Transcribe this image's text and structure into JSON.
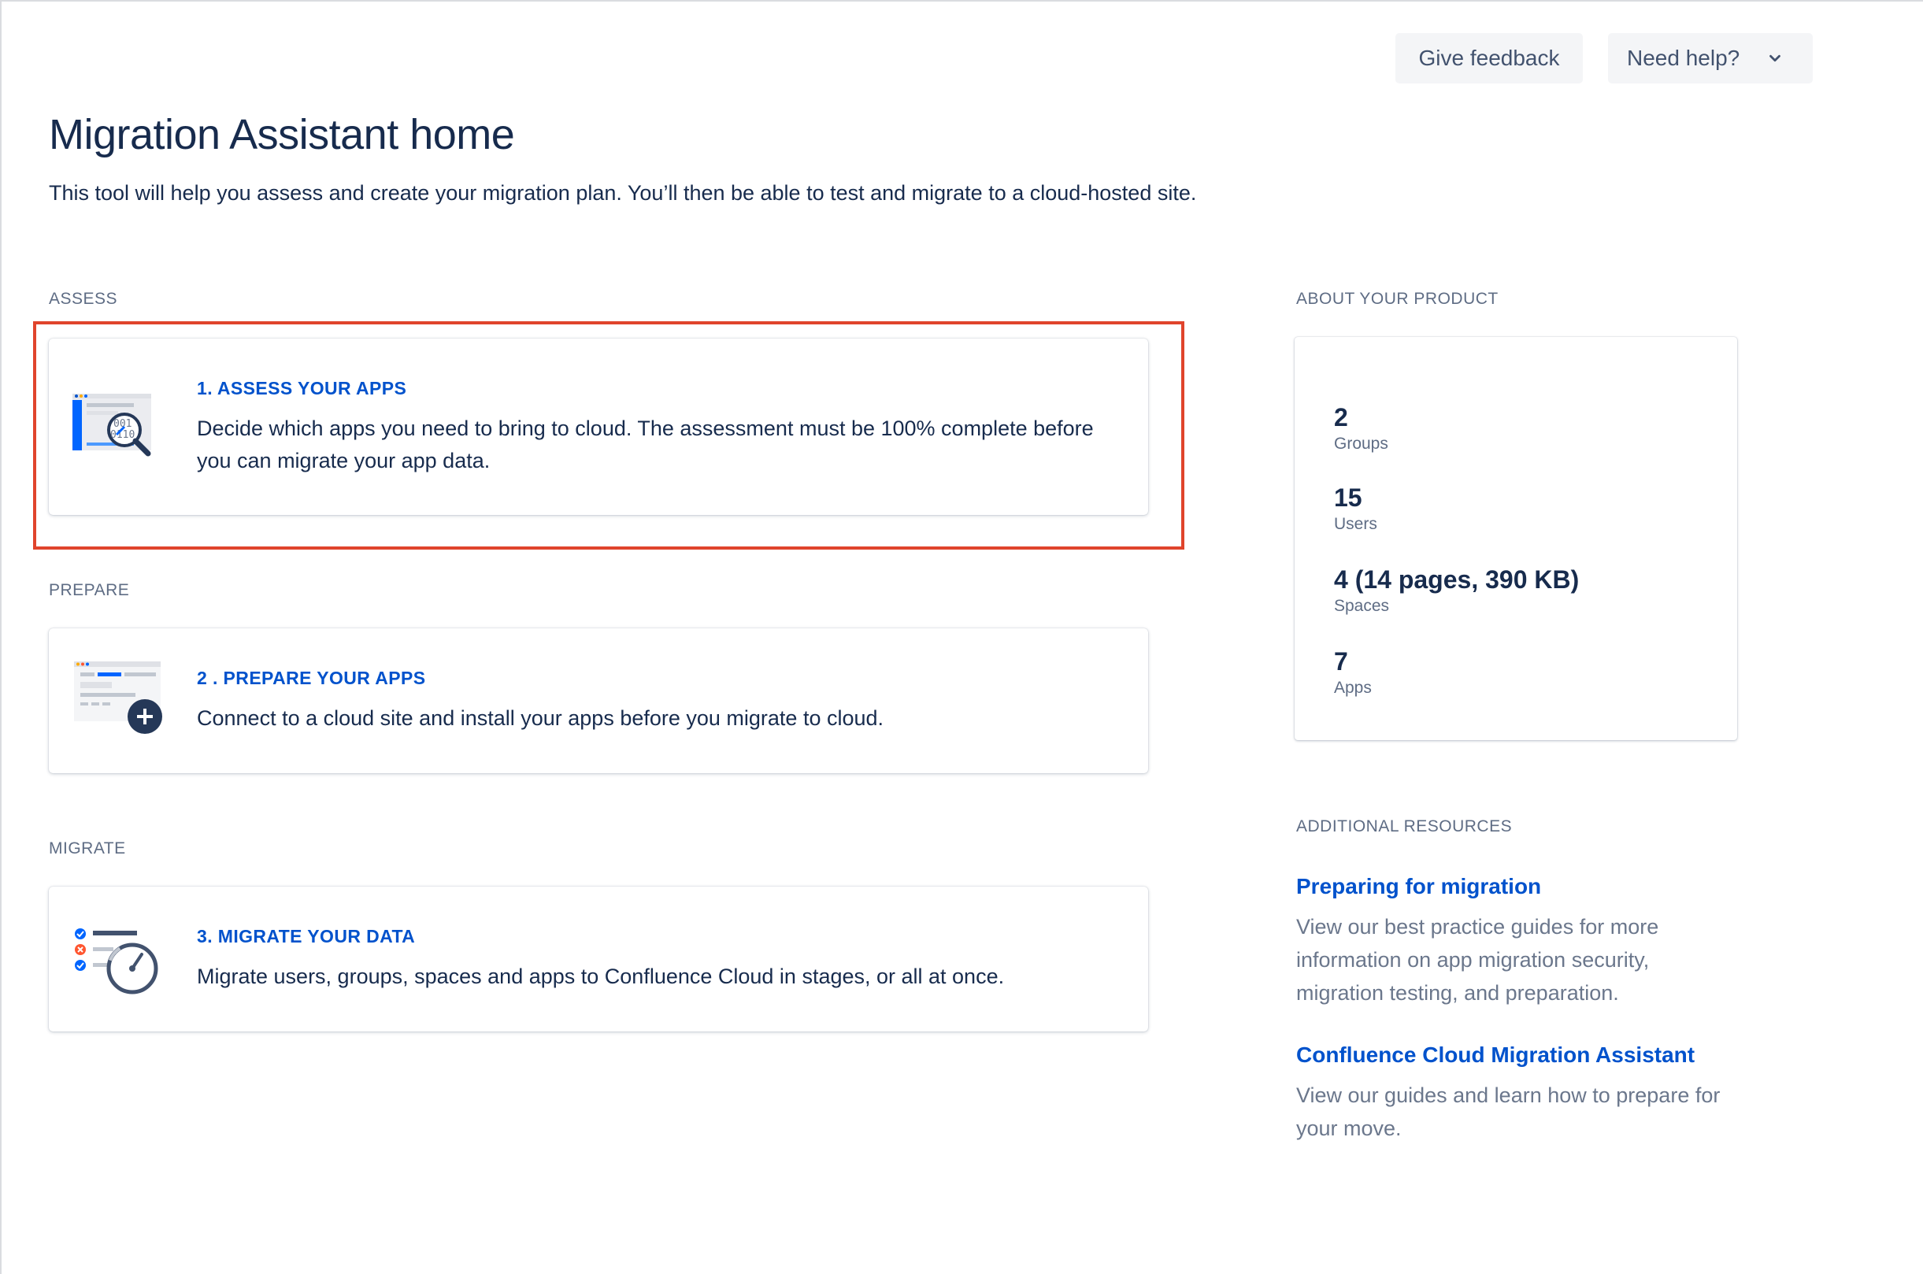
{
  "header": {
    "feedback_label": "Give feedback",
    "help_label": "Need help?"
  },
  "page": {
    "title": "Migration Assistant home",
    "description": "This tool will help you assess and create your migration plan. You’ll then be able to test and migrate to a cloud-hosted site."
  },
  "sections": {
    "assess": "ASSESS",
    "prepare": "PREPARE",
    "migrate": "MIGRATE"
  },
  "cards": [
    {
      "title": "1. ASSESS YOUR APPS",
      "description": "Decide which apps you need to bring to cloud. The assessment must be 100% complete before you can migrate your app data.",
      "icon": "magnifier-report-icon",
      "highlighted": true
    },
    {
      "title": "2 . PREPARE YOUR APPS",
      "description": "Connect to a cloud site and install your apps before you migrate to cloud.",
      "icon": "add-app-icon"
    },
    {
      "title": "3. MIGRATE YOUR DATA",
      "description": "Migrate users, groups, spaces and apps to Confluence Cloud in stages, or all at once.",
      "icon": "checklist-gauge-icon"
    }
  ],
  "about": {
    "label": "ABOUT YOUR PRODUCT",
    "stats": [
      {
        "value": "2",
        "label": "Groups"
      },
      {
        "value": "15",
        "label": "Users"
      },
      {
        "value": "4 (14 pages, 390 KB)",
        "label": "Spaces"
      },
      {
        "value": "7",
        "label": "Apps"
      }
    ]
  },
  "resources": {
    "label": "ADDITIONAL RESOURCES",
    "items": [
      {
        "title": "Preparing for migration",
        "description": "View our best practice guides for more information on app migration security, migration testing, and preparation."
      },
      {
        "title": "Confluence Cloud Migration Assistant",
        "description": "View our guides and learn how to prepare for your move."
      }
    ]
  },
  "colors": {
    "link": "#0052CC",
    "highlight": "#E0442C",
    "text": "#172B4D",
    "muted": "#5E6C84"
  }
}
